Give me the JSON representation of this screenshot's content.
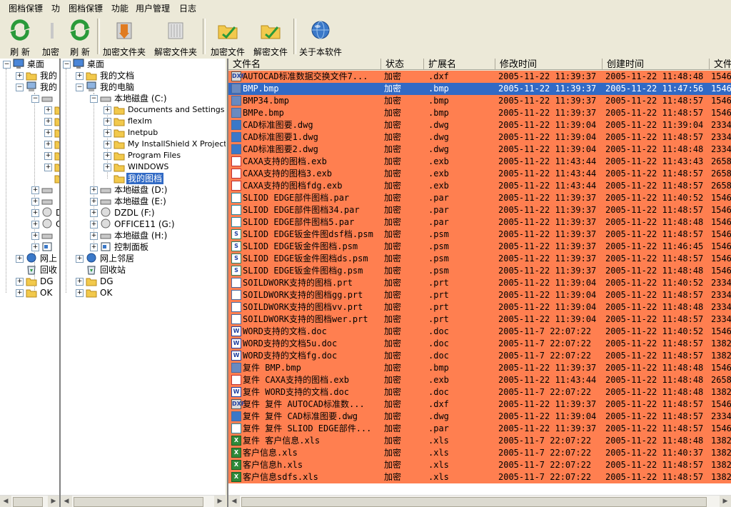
{
  "menu": {
    "left": [
      "图档保镖",
      "功"
    ],
    "right": [
      "图档保镖",
      "功能",
      "用户管理",
      "日志"
    ]
  },
  "toolbar": {
    "left_refresh": "刷 新",
    "left_encrypt_partial": "加密",
    "refresh": "刷 新",
    "encrypt_folder": "加密文件夹",
    "decrypt_folder": "解密文件夹",
    "encrypt_file": "加密文件",
    "decrypt_file": "解密文件",
    "about": "关于本软件"
  },
  "tree_left": {
    "desktop": "桌面",
    "my_docs": "我的",
    "my_pc": "我的",
    "dz": "DZ",
    "c": "C",
    "network": "网上",
    "recycle": "回收",
    "dg": "DG",
    "ok": "OK"
  },
  "tree_right": {
    "desktop": "桌面",
    "my_docs": "我的文档",
    "my_pc": "我的电脑",
    "drive_c": "本地磁盘 (C:)",
    "c_children": [
      "Documents and Settings",
      "flexlm",
      "Inetpub",
      "My InstallShield X Projects",
      "Program Files",
      "WINDOWS",
      "我的图档"
    ],
    "drive_d": "本地磁盘 (D:)",
    "drive_e": "本地磁盘 (E:)",
    "drive_f": "DZDL (F:)",
    "drive_g": "OFFICE11 (G:)",
    "drive_h": "本地磁盘 (H:)",
    "control_panel": "控制面板",
    "network": "网上邻居",
    "recycle": "回收站",
    "dg": "DG",
    "ok": "OK"
  },
  "list": {
    "columns": [
      "文件名",
      "状态",
      "扩展名",
      "修改时间",
      "创建时间",
      "文件"
    ],
    "rows": [
      {
        "name": "AUTOCAD标准数据交换文件7...",
        "status": "加密",
        "ext": ".dxf",
        "mtime": "2005-11-22 11:39:37",
        "ctime": "2005-11-22 11:48:48",
        "size": "1546",
        "type": "dxf",
        "icon_text": "DXF"
      },
      {
        "name": "BMP.bmp",
        "status": "加密",
        "ext": ".bmp",
        "mtime": "2005-11-22 11:39:37",
        "ctime": "2005-11-22 11:47:56",
        "size": "1546",
        "type": "bmp",
        "icon_text": "",
        "selected": true
      },
      {
        "name": "BMP34.bmp",
        "status": "加密",
        "ext": ".bmp",
        "mtime": "2005-11-22 11:39:37",
        "ctime": "2005-11-22 11:48:57",
        "size": "1546",
        "type": "bmp",
        "icon_text": ""
      },
      {
        "name": "BMPe.bmp",
        "status": "加密",
        "ext": ".bmp",
        "mtime": "2005-11-22 11:39:37",
        "ctime": "2005-11-22 11:48:57",
        "size": "1546",
        "type": "bmp",
        "icon_text": ""
      },
      {
        "name": "CAD标准图要.dwg",
        "status": "加密",
        "ext": ".dwg",
        "mtime": "2005-11-22 11:39:04",
        "ctime": "2005-11-22 11:39:04",
        "size": "2334",
        "type": "dwg",
        "icon_text": ""
      },
      {
        "name": "CAD标准图要1.dwg",
        "status": "加密",
        "ext": ".dwg",
        "mtime": "2005-11-22 11:39:04",
        "ctime": "2005-11-22 11:48:57",
        "size": "2334",
        "type": "dwg",
        "icon_text": ""
      },
      {
        "name": "CAD标准图要2.dwg",
        "status": "加密",
        "ext": ".dwg",
        "mtime": "2005-11-22 11:39:04",
        "ctime": "2005-11-22 11:48:48",
        "size": "2334",
        "type": "dwg",
        "icon_text": ""
      },
      {
        "name": "CAXA支持的图档.exb",
        "status": "加密",
        "ext": ".exb",
        "mtime": "2005-11-22 11:43:44",
        "ctime": "2005-11-22 11:43:43",
        "size": "2658",
        "type": "exb",
        "icon_text": ""
      },
      {
        "name": "CAXA支持的图档3.exb",
        "status": "加密",
        "ext": ".exb",
        "mtime": "2005-11-22 11:43:44",
        "ctime": "2005-11-22 11:48:57",
        "size": "2658",
        "type": "exb",
        "icon_text": ""
      },
      {
        "name": "CAXA支持的图档fdg.exb",
        "status": "加密",
        "ext": ".exb",
        "mtime": "2005-11-22 11:43:44",
        "ctime": "2005-11-22 11:48:57",
        "size": "2658",
        "type": "exb",
        "icon_text": ""
      },
      {
        "name": "SLIOD EDGE部件图档.par",
        "status": "加密",
        "ext": ".par",
        "mtime": "2005-11-22 11:39:37",
        "ctime": "2005-11-22 11:40:52",
        "size": "1546",
        "type": "par",
        "icon_text": ""
      },
      {
        "name": "SLIOD EDGE部件图档34.par",
        "status": "加密",
        "ext": ".par",
        "mtime": "2005-11-22 11:39:37",
        "ctime": "2005-11-22 11:48:57",
        "size": "1546",
        "type": "par",
        "icon_text": ""
      },
      {
        "name": "SLIOD EDGE部件图档5.par",
        "status": "加密",
        "ext": ".par",
        "mtime": "2005-11-22 11:39:37",
        "ctime": "2005-11-22 11:48:48",
        "size": "1546",
        "type": "par",
        "icon_text": ""
      },
      {
        "name": "SLIOD EDGE钣金件图dsf档.psm",
        "status": "加密",
        "ext": ".psm",
        "mtime": "2005-11-22 11:39:37",
        "ctime": "2005-11-22 11:48:57",
        "size": "1546",
        "type": "psm",
        "icon_text": "S"
      },
      {
        "name": "SLIOD EDGE钣金件图档.psm",
        "status": "加密",
        "ext": ".psm",
        "mtime": "2005-11-22 11:39:37",
        "ctime": "2005-11-22 11:46:45",
        "size": "1546",
        "type": "psm",
        "icon_text": "S"
      },
      {
        "name": "SLIOD EDGE钣金件图档ds.psm",
        "status": "加密",
        "ext": ".psm",
        "mtime": "2005-11-22 11:39:37",
        "ctime": "2005-11-22 11:48:57",
        "size": "1546",
        "type": "psm",
        "icon_text": "S"
      },
      {
        "name": "SLIOD EDGE钣金件图档g.psm",
        "status": "加密",
        "ext": ".psm",
        "mtime": "2005-11-22 11:39:37",
        "ctime": "2005-11-22 11:48:48",
        "size": "1546",
        "type": "psm",
        "icon_text": "S"
      },
      {
        "name": "SOILDWORK支持的图档.prt",
        "status": "加密",
        "ext": ".prt",
        "mtime": "2005-11-22 11:39:04",
        "ctime": "2005-11-22 11:40:52",
        "size": "2334",
        "type": "prt",
        "icon_text": ""
      },
      {
        "name": "SOILDWORK支持的图档gg.prt",
        "status": "加密",
        "ext": ".prt",
        "mtime": "2005-11-22 11:39:04",
        "ctime": "2005-11-22 11:48:57",
        "size": "2334",
        "type": "prt",
        "icon_text": ""
      },
      {
        "name": "SOILDWORK支持的图档vv.prt",
        "status": "加密",
        "ext": ".prt",
        "mtime": "2005-11-22 11:39:04",
        "ctime": "2005-11-22 11:48:48",
        "size": "2334",
        "type": "prt",
        "icon_text": ""
      },
      {
        "name": "SOILDWORK支持的图档wer.prt",
        "status": "加密",
        "ext": ".prt",
        "mtime": "2005-11-22 11:39:04",
        "ctime": "2005-11-22 11:48:57",
        "size": "2334",
        "type": "prt",
        "icon_text": ""
      },
      {
        "name": "WORD支持的文档.doc",
        "status": "加密",
        "ext": ".doc",
        "mtime": "2005-11-7 22:07:22",
        "ctime": "2005-11-22 11:40:52",
        "size": "1546",
        "type": "doc",
        "icon_text": "W"
      },
      {
        "name": "WORD支持的文档5u.doc",
        "status": "加密",
        "ext": ".doc",
        "mtime": "2005-11-7 22:07:22",
        "ctime": "2005-11-22 11:48:57",
        "size": "1382",
        "type": "doc",
        "icon_text": "W"
      },
      {
        "name": "WORD支持的文档fg.doc",
        "status": "加密",
        "ext": ".doc",
        "mtime": "2005-11-7 22:07:22",
        "ctime": "2005-11-22 11:48:57",
        "size": "1382",
        "type": "doc",
        "icon_text": "W"
      },
      {
        "name": "复件 BMP.bmp",
        "status": "加密",
        "ext": ".bmp",
        "mtime": "2005-11-22 11:39:37",
        "ctime": "2005-11-22 11:48:48",
        "size": "1546",
        "type": "bmp",
        "icon_text": ""
      },
      {
        "name": "复件 CAXA支持的图档.exb",
        "status": "加密",
        "ext": ".exb",
        "mtime": "2005-11-22 11:43:44",
        "ctime": "2005-11-22 11:48:48",
        "size": "2658",
        "type": "exb",
        "icon_text": ""
      },
      {
        "name": "复件 WORD支持的文档.doc",
        "status": "加密",
        "ext": ".doc",
        "mtime": "2005-11-7 22:07:22",
        "ctime": "2005-11-22 11:48:48",
        "size": "1382",
        "type": "doc",
        "icon_text": "W"
      },
      {
        "name": "复件 复件 AUTOCAD标准数...",
        "status": "加密",
        "ext": ".dxf",
        "mtime": "2005-11-22 11:39:37",
        "ctime": "2005-11-22 11:48:57",
        "size": "1546",
        "type": "dxf",
        "icon_text": "DXF"
      },
      {
        "name": "复件 复件 CAD标准图要.dwg",
        "status": "加密",
        "ext": ".dwg",
        "mtime": "2005-11-22 11:39:04",
        "ctime": "2005-11-22 11:48:57",
        "size": "2334",
        "type": "dwg",
        "icon_text": ""
      },
      {
        "name": "复件 复件 SLIOD EDGE部件...",
        "status": "加密",
        "ext": ".par",
        "mtime": "2005-11-22 11:39:37",
        "ctime": "2005-11-22 11:48:57",
        "size": "1546",
        "type": "par",
        "icon_text": ""
      },
      {
        "name": "复件 客户信息.xls",
        "status": "加密",
        "ext": ".xls",
        "mtime": "2005-11-7 22:07:22",
        "ctime": "2005-11-22 11:48:48",
        "size": "1382",
        "type": "xls",
        "icon_text": "X"
      },
      {
        "name": "客户信息.xls",
        "status": "加密",
        "ext": ".xls",
        "mtime": "2005-11-7 22:07:22",
        "ctime": "2005-11-22 11:40:37",
        "size": "1382",
        "type": "xls",
        "icon_text": "X"
      },
      {
        "name": "客户信息h.xls",
        "status": "加密",
        "ext": ".xls",
        "mtime": "2005-11-7 22:07:22",
        "ctime": "2005-11-22 11:48:57",
        "size": "1382",
        "type": "xls",
        "icon_text": "X"
      },
      {
        "name": "客户信息sdfs.xls",
        "status": "加密",
        "ext": ".xls",
        "mtime": "2005-11-7 22:07:22",
        "ctime": "2005-11-22 11:48:57",
        "size": "1382",
        "type": "xls",
        "icon_text": "X"
      }
    ]
  },
  "colors": {
    "row_bg": "#ff7f50",
    "selection": "#316ac5",
    "chrome": "#ece9d8"
  }
}
